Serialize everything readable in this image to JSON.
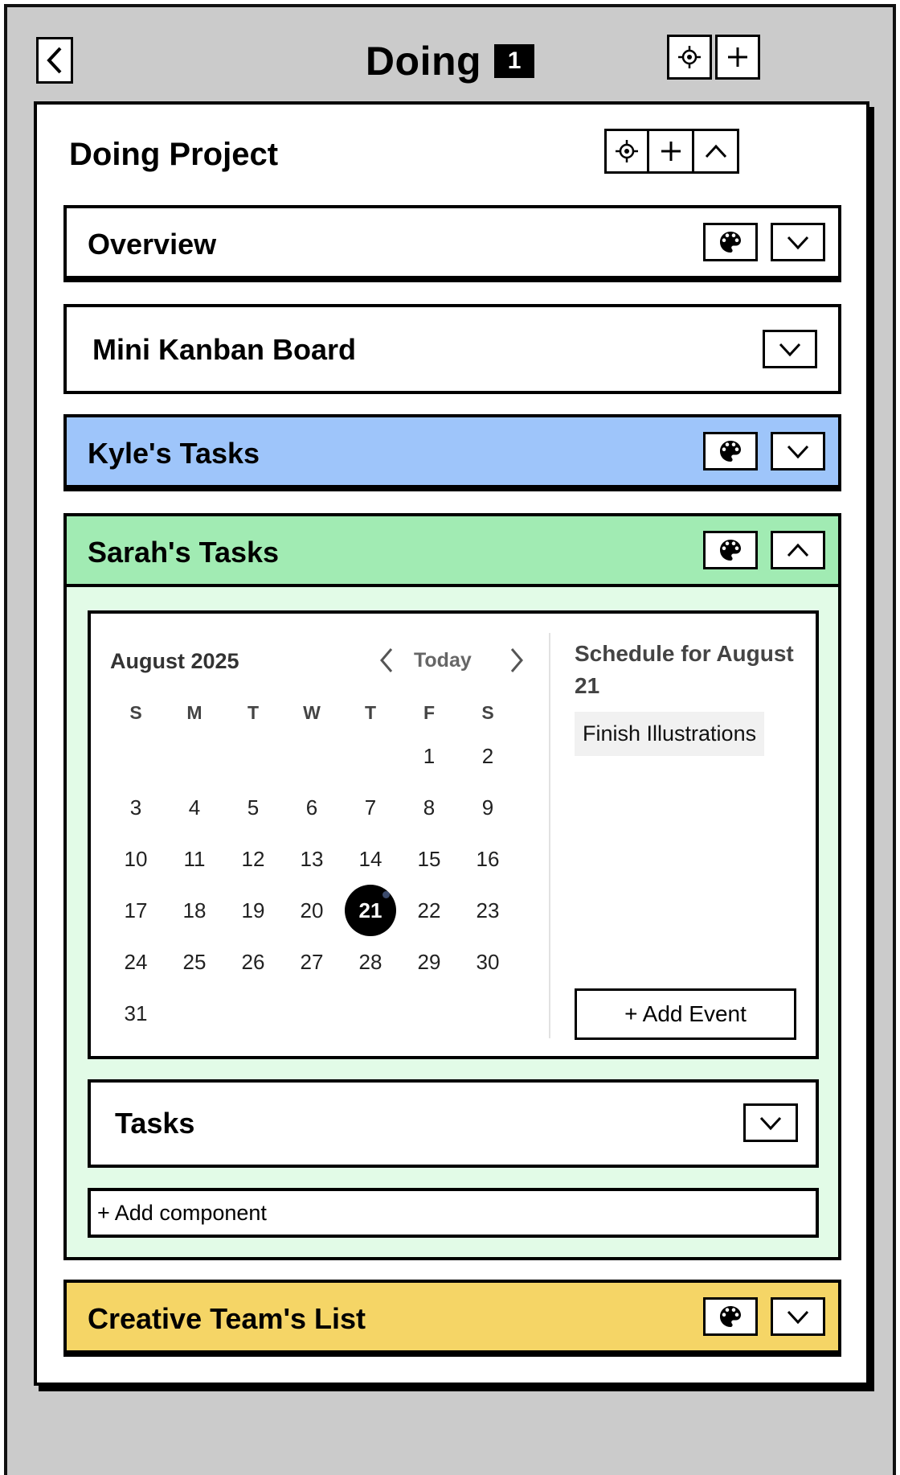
{
  "header": {
    "title": "Doing",
    "count": "1"
  },
  "project": {
    "title": "Doing Project"
  },
  "sections": {
    "overview": {
      "title": "Overview"
    },
    "kanban": {
      "title": "Mini Kanban Board"
    },
    "kyle": {
      "title": "Kyle's Tasks"
    },
    "sarah": {
      "title": "Sarah's Tasks"
    },
    "creative": {
      "title": "Creative Team's List"
    }
  },
  "colors": {
    "kyle": "#9ec5fa",
    "sarah": "#a1ebb3",
    "sarah_bg": "#e2fbe7",
    "creative": "#f5d566",
    "frame": "#cbcbcb"
  },
  "calendar": {
    "month": "August 2025",
    "today_label": "Today",
    "weekdays": [
      "S",
      "M",
      "T",
      "W",
      "T",
      "F",
      "S"
    ],
    "days": [
      "1",
      "2",
      "3",
      "4",
      "5",
      "6",
      "7",
      "8",
      "9",
      "10",
      "11",
      "12",
      "13",
      "14",
      "15",
      "16",
      "17",
      "18",
      "19",
      "20",
      "21",
      "22",
      "23",
      "24",
      "25",
      "26",
      "27",
      "28",
      "29",
      "30",
      "31"
    ],
    "selected_day": "21",
    "schedule_title": "Schedule for August 21",
    "events": [
      "Finish Illustrations"
    ],
    "add_event_label": "+ Add Event"
  },
  "tasks": {
    "title": "Tasks"
  },
  "add_component_label": "+ Add component"
}
